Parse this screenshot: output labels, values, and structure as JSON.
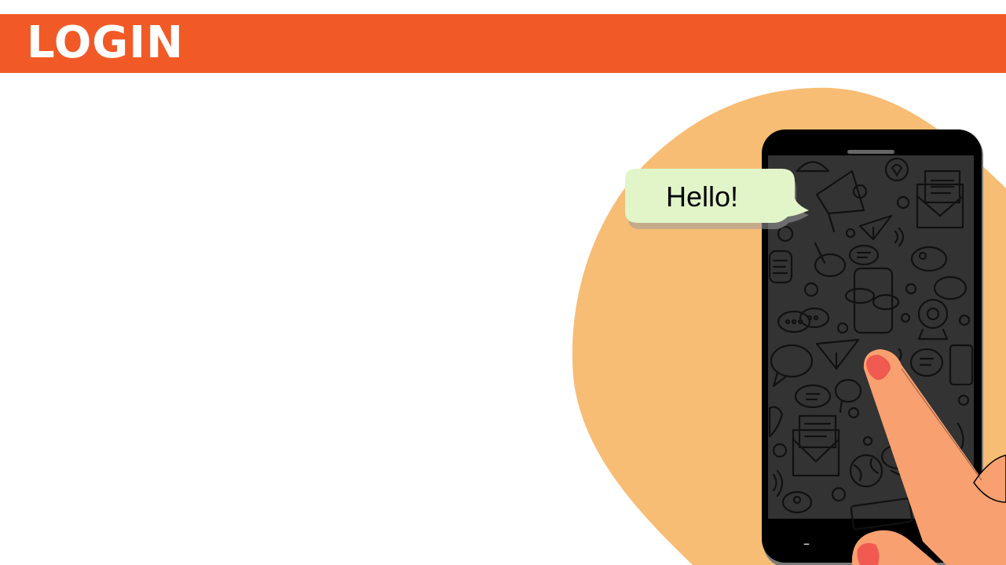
{
  "header": {
    "title": "LOGIN"
  },
  "speech_bubble": {
    "text": "Hello!"
  },
  "phone": {
    "nav_home_symbol": "–",
    "nav_back_symbol": "‹"
  },
  "colors": {
    "header_orange": "#f15a27",
    "blob_peach": "#f7bd74",
    "phone_black": "#000000",
    "screen_dark": "#333333",
    "bubble_green": "#e1f5c9",
    "hand_skin": "#f9a070",
    "nail_red": "#f05a50"
  },
  "icons": [
    "megaphone-icon",
    "envelope-icon",
    "paper-plane-icon",
    "heart-icon",
    "chat-bubble-icon",
    "hello-doodle",
    "hi-doodle",
    "globe-icon",
    "webcam-icon"
  ]
}
